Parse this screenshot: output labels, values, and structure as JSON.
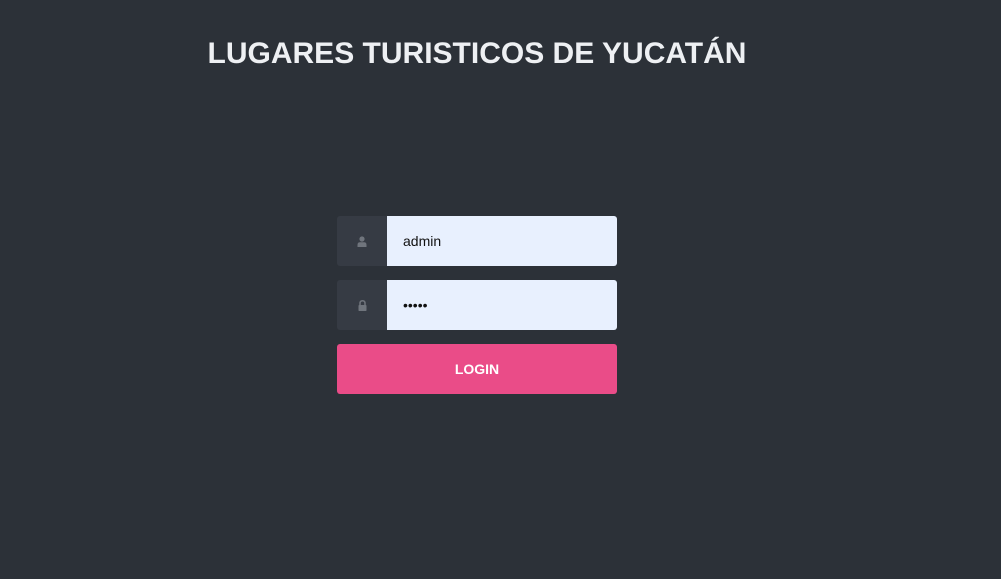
{
  "header": {
    "title": "LUGARES TURISTICOS DE YUCATÁN"
  },
  "login_form": {
    "username": {
      "value": "admin",
      "icon": "user-icon"
    },
    "password": {
      "value": "•••••",
      "icon": "lock-icon"
    },
    "submit_label": "LOGIN"
  },
  "colors": {
    "background": "#2c3138",
    "icon_box": "#363b44",
    "input_background": "#e8f0fe",
    "accent": "#ea4c88"
  }
}
